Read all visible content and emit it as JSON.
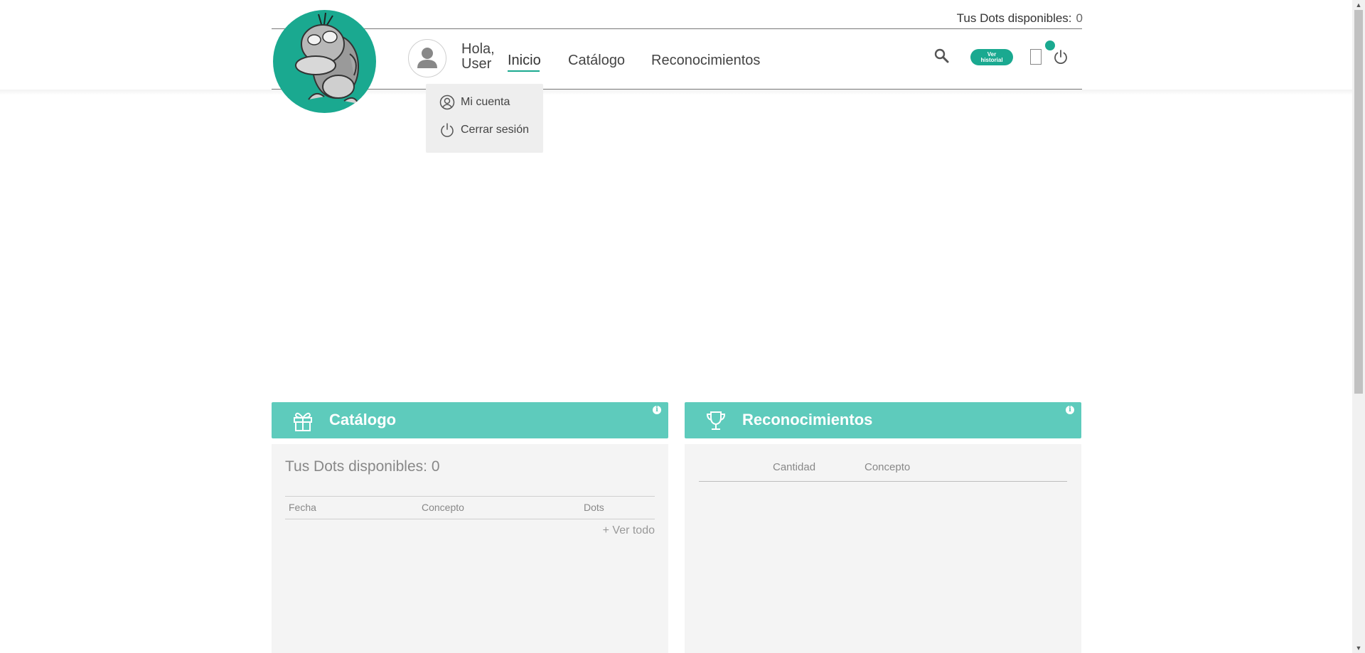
{
  "topbar": {
    "dots_label": "Tus Dots disponibles:",
    "dots_value": "0"
  },
  "user": {
    "greeting_line1": "Hola,",
    "greeting_line2": "User"
  },
  "nav": {
    "items": [
      {
        "label": "Inicio",
        "active": true
      },
      {
        "label": "Catálogo",
        "active": false
      },
      {
        "label": "Reconocimientos",
        "active": false
      }
    ]
  },
  "actions": {
    "ver_historial_line1": "Ver",
    "ver_historial_line2": "historial"
  },
  "dropdown": {
    "items": [
      {
        "label": "Mi cuenta",
        "icon": "user-circle-icon"
      },
      {
        "label": "Cerrar sesión",
        "icon": "power-icon"
      }
    ]
  },
  "catalogo_panel": {
    "title": "Catálogo",
    "info": "i",
    "dots_text": "Tus Dots disponibles: 0",
    "columns": [
      "Fecha",
      "Concepto",
      "Dots"
    ],
    "link": "+ Ver todo"
  },
  "reconocimientos_panel": {
    "title": "Reconocimientos",
    "info": "i",
    "columns": [
      "Cantidad",
      "Concepto"
    ]
  },
  "colors": {
    "accent": "#1aa990",
    "panel_header": "#5ecbbc",
    "panel_body": "#f4f4f4"
  }
}
